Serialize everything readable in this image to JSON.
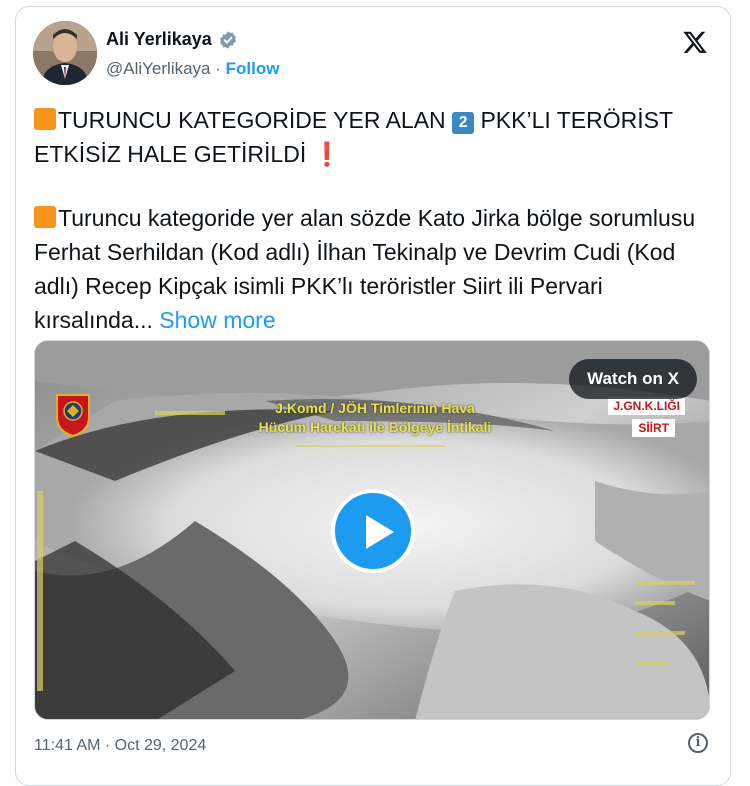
{
  "author": {
    "name": "Ali Yerlikaya",
    "handle": "@AliYerlikaya",
    "separator": " · ",
    "follow_label": "Follow",
    "verified_badge": "verified-icon"
  },
  "platform_logo": "x-logo-icon",
  "tweet": {
    "line1_text1": "TURUNCU KATEGORİDE YER ALAN ",
    "line1_keycap": "2",
    "line1_text2": " PKK’LI TERÖRİST ETKİSİZ HALE GETİRİLDİ ",
    "line1_excl": "❗",
    "para2_text": "Turuncu kategoride yer alan sözde Kato Jirka bölge sorumlusu Ferhat Serhildan (Kod adlı) İlhan Tekinalp ve Devrim Cudi (Kod adlı) Recep Kipçak isimli PKK’lı teröristler Siirt ili Pervari kırsalında... ",
    "show_more": "Show more"
  },
  "media": {
    "watch_label": "Watch on X",
    "overlay_line1": "J.Komd / JÖH Timlerinin Hava",
    "overlay_line2": "Hücum Harekatı ile Bölgeye İntikali",
    "unit_label1": "J.GN.K.LIĞI",
    "unit_label2": "SİİRT",
    "play_icon": "play-icon"
  },
  "timestamp": "11:41 AM · Oct 29, 2024",
  "info_icon": "info-icon",
  "colors": {
    "accent": "#1d9bf0",
    "orange_square": "#f7941d",
    "keycap_blue": "#3b88c3",
    "overlay_yellow": "#e6e24a",
    "unit_red": "#c4161c"
  }
}
